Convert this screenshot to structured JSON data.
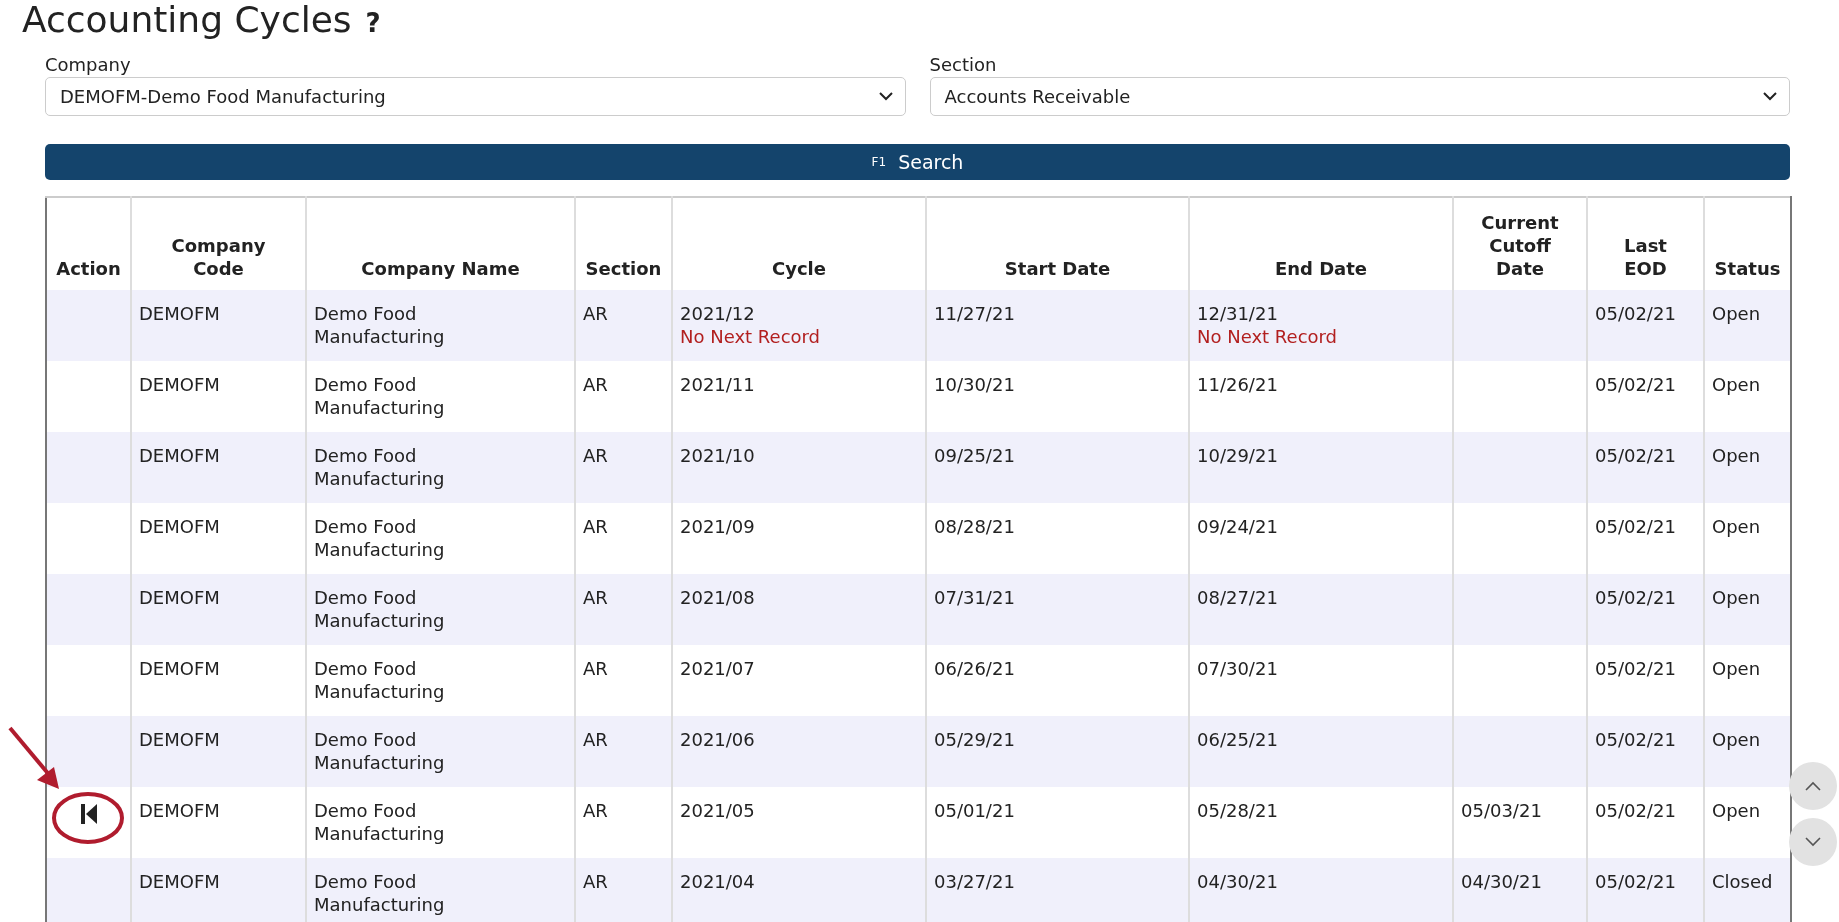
{
  "page": {
    "title": "Accounting Cycles",
    "help": "?"
  },
  "filters": [
    {
      "label": "Company",
      "value": "DEMOFM-Demo Food Manufacturing"
    },
    {
      "label": "Section",
      "value": "Accounts Receivable"
    }
  ],
  "search_button": {
    "key": "F1",
    "label": "Search"
  },
  "table": {
    "columns": [
      "Action",
      "Company Code",
      "Company Name",
      "Section",
      "Cycle",
      "Start Date",
      "End Date",
      "Current Cutoff Date",
      "Last EOD",
      "Status"
    ],
    "rows": [
      {
        "action": false,
        "circled": false,
        "code": "DEMOFM",
        "name": "Demo Food Manufacturing",
        "section": "AR",
        "cycle": "2021/12",
        "cycle_note": "No Next Record",
        "start": "11/27/21",
        "end": "12/31/21",
        "end_note": "No Next Record",
        "cutoff": "",
        "last_eod": "05/02/21",
        "status": "Open"
      },
      {
        "action": false,
        "circled": false,
        "code": "DEMOFM",
        "name": "Demo Food Manufacturing",
        "section": "AR",
        "cycle": "2021/11",
        "start": "10/30/21",
        "end": "11/26/21",
        "cutoff": "",
        "last_eod": "05/02/21",
        "status": "Open"
      },
      {
        "action": false,
        "circled": false,
        "code": "DEMOFM",
        "name": "Demo Food Manufacturing",
        "section": "AR",
        "cycle": "2021/10",
        "start": "09/25/21",
        "end": "10/29/21",
        "cutoff": "",
        "last_eod": "05/02/21",
        "status": "Open"
      },
      {
        "action": false,
        "circled": false,
        "code": "DEMOFM",
        "name": "Demo Food Manufacturing",
        "section": "AR",
        "cycle": "2021/09",
        "start": "08/28/21",
        "end": "09/24/21",
        "cutoff": "",
        "last_eod": "05/02/21",
        "status": "Open"
      },
      {
        "action": false,
        "circled": false,
        "code": "DEMOFM",
        "name": "Demo Food Manufacturing",
        "section": "AR",
        "cycle": "2021/08",
        "start": "07/31/21",
        "end": "08/27/21",
        "cutoff": "",
        "last_eod": "05/02/21",
        "status": "Open"
      },
      {
        "action": false,
        "circled": false,
        "code": "DEMOFM",
        "name": "Demo Food Manufacturing",
        "section": "AR",
        "cycle": "2021/07",
        "start": "06/26/21",
        "end": "07/30/21",
        "cutoff": "",
        "last_eod": "05/02/21",
        "status": "Open"
      },
      {
        "action": false,
        "circled": false,
        "code": "DEMOFM",
        "name": "Demo Food Manufacturing",
        "section": "AR",
        "cycle": "2021/06",
        "start": "05/29/21",
        "end": "06/25/21",
        "cutoff": "",
        "last_eod": "05/02/21",
        "status": "Open"
      },
      {
        "action": true,
        "circled": true,
        "code": "DEMOFM",
        "name": "Demo Food Manufacturing",
        "section": "AR",
        "cycle": "2021/05",
        "start": "05/01/21",
        "end": "05/28/21",
        "cutoff": "05/03/21",
        "last_eod": "05/02/21",
        "status": "Open"
      },
      {
        "action": false,
        "circled": false,
        "code": "DEMOFM",
        "name": "Demo Food Manufacturing",
        "section": "AR",
        "cycle": "2021/04",
        "start": "03/27/21",
        "end": "04/30/21",
        "cutoff": "04/30/21",
        "last_eod": "05/02/21",
        "status": "Closed"
      }
    ]
  }
}
